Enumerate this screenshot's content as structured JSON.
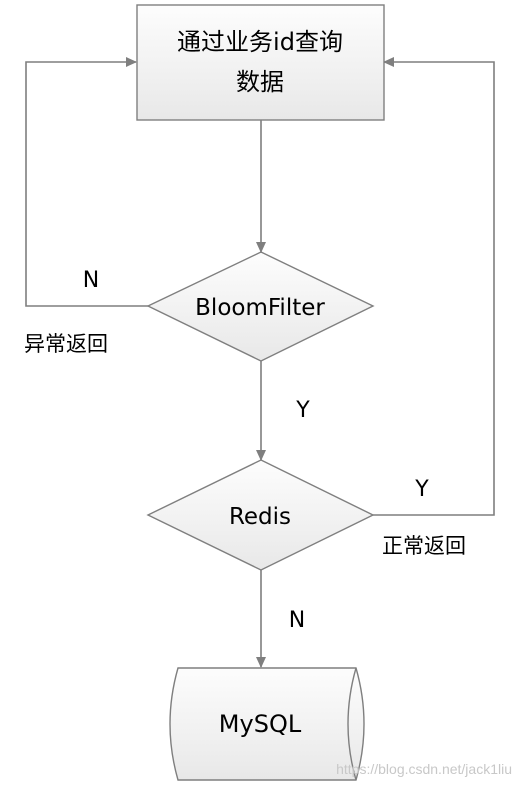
{
  "nodes": {
    "start": {
      "line1": "通过业务id查询",
      "line2": "数据"
    },
    "bloom": {
      "label": "BloomFilter"
    },
    "redis": {
      "label": "Redis"
    },
    "mysql": {
      "label": "MySQL"
    }
  },
  "edges": {
    "bloom_no": {
      "label": "N",
      "note": "异常返回"
    },
    "bloom_yes": {
      "label": "Y"
    },
    "redis_yes": {
      "label": "Y",
      "note": "正常返回"
    },
    "redis_no": {
      "label": "N"
    }
  },
  "watermark": "https://blog.csdn.net/jack1liu",
  "colors": {
    "stroke": "#7f7f7f",
    "fill_light": "#fbfbfb",
    "fill_dark": "#e9e9e9",
    "text": "#000000"
  }
}
